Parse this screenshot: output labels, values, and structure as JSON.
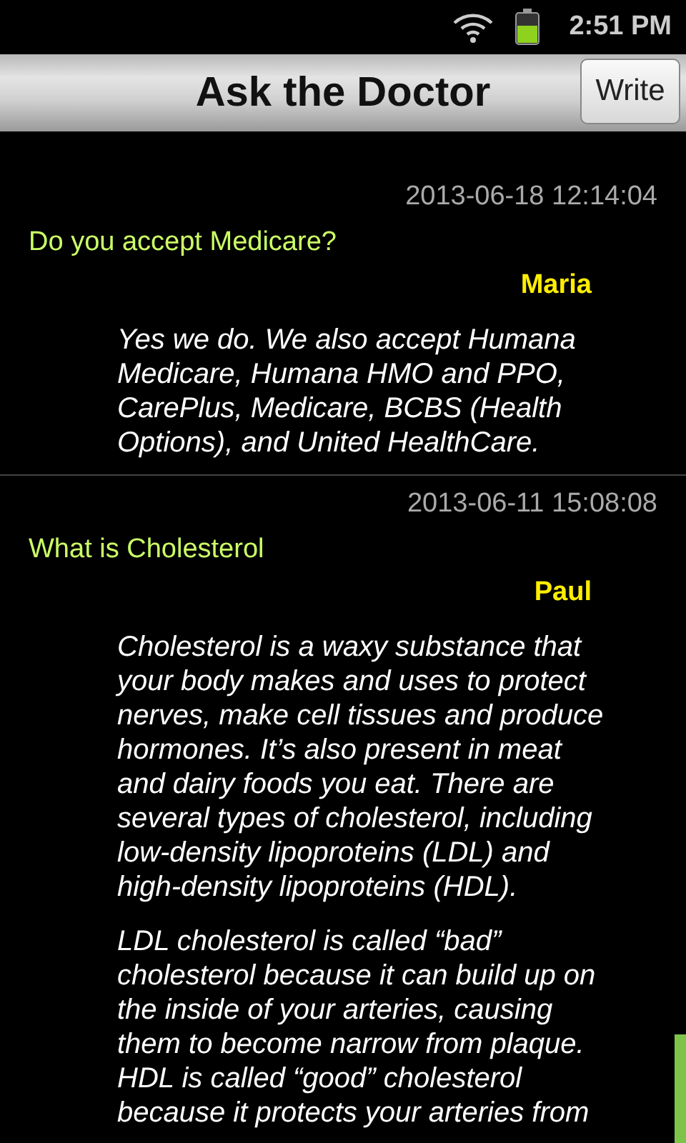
{
  "status_bar": {
    "time": "2:51 PM"
  },
  "title_bar": {
    "title": "Ask the Doctor",
    "button": "Write"
  },
  "posts": [
    {
      "date": "2013-06-18 12:14:04",
      "question": "Do you accept Medicare?",
      "author": "Maria",
      "answer": [
        "Yes we do. We also accept Humana Medicare, Humana HMO and PPO, CarePlus, Medicare, BCBS (Health Options), and United HealthCare."
      ]
    },
    {
      "date": "2013-06-11 15:08:08",
      "question": "What is Cholesterol",
      "author": "Paul",
      "answer": [
        "Cholesterol is a waxy substance that your body makes and uses to protect nerves, make cell tissues and produce hormones. It’s also present in meat and dairy foods you eat. There are several types of cholesterol, including low-density lipoproteins (LDL) and high-density lipoproteins (HDL).",
        "LDL cholesterol is called “bad” cholesterol because it can build up on the inside of your arteries, causing them to become narrow from plaque. HDL is called “good” cholesterol because it protects your arteries from"
      ]
    }
  ]
}
